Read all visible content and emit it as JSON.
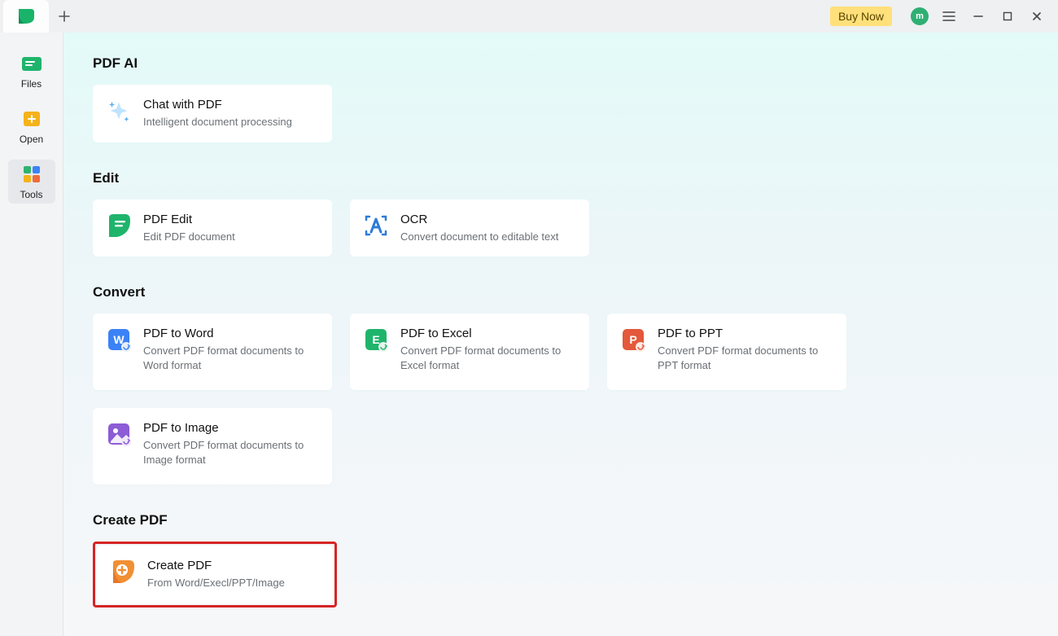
{
  "titlebar": {
    "buy_now": "Buy Now",
    "avatar_letter": "m"
  },
  "sidebar": {
    "items": [
      {
        "label": "Files"
      },
      {
        "label": "Open"
      },
      {
        "label": "Tools"
      }
    ]
  },
  "sections": {
    "pdf_ai": {
      "heading": "PDF AI",
      "cards": [
        {
          "title": "Chat with PDF",
          "sub": "Intelligent document processing"
        }
      ]
    },
    "edit": {
      "heading": "Edit",
      "cards": [
        {
          "title": "PDF Edit",
          "sub": "Edit PDF document"
        },
        {
          "title": "OCR",
          "sub": "Convert document to editable text"
        }
      ]
    },
    "convert": {
      "heading": "Convert",
      "cards": [
        {
          "title": "PDF to Word",
          "sub": "Convert PDF format documents to Word format"
        },
        {
          "title": "PDF to Excel",
          "sub": "Convert PDF format documents to Excel format"
        },
        {
          "title": "PDF to PPT",
          "sub": "Convert PDF format documents to PPT format"
        },
        {
          "title": "PDF to Image",
          "sub": "Convert PDF format documents to Image format"
        }
      ]
    },
    "create": {
      "heading": "Create PDF",
      "cards": [
        {
          "title": "Create PDF",
          "sub": "From Word/Execl/PPT/Image"
        }
      ]
    }
  }
}
